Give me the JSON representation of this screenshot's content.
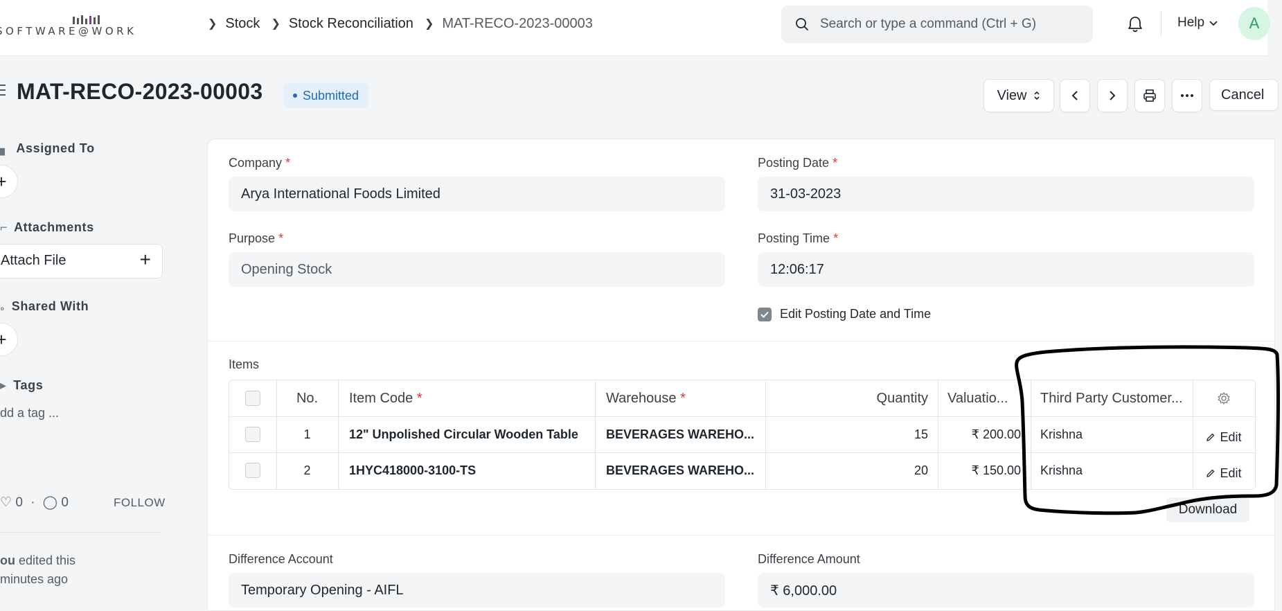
{
  "app": {
    "logo_text": "SOFTWARE@WORK"
  },
  "breadcrumb": [
    "Stock",
    "Stock Reconciliation",
    "MAT-RECO-2023-00003"
  ],
  "search": {
    "placeholder": "Search or type a command (Ctrl + G)"
  },
  "navbar": {
    "help_label": "Help",
    "avatar_initial": "A"
  },
  "page": {
    "title": "MAT-RECO-2023-00003",
    "status": "Submitted",
    "actions": {
      "view_label": "View",
      "cancel_label": "Cancel"
    }
  },
  "sidebar": {
    "assigned_to": "Assigned To",
    "attachments": "Attachments",
    "attach_file": "Attach File",
    "shared_with": "Shared With",
    "tags": "Tags",
    "add_tag": "dd a tag ...",
    "likes": "0",
    "comments": "0",
    "follow": "FOLLOW",
    "activity_line1_bold": "ou",
    "activity_line1_rest": " edited this",
    "activity_line2": "minutes ago"
  },
  "form": {
    "company_label": "Company",
    "company_value": "Arya International Foods Limited",
    "posting_date_label": "Posting Date",
    "posting_date_value": "31-03-2023",
    "purpose_label": "Purpose",
    "purpose_value": "Opening Stock",
    "posting_time_label": "Posting Time",
    "posting_time_value": "12:06:17",
    "edit_posting_label": "Edit Posting Date and Time",
    "edit_posting_checked": true,
    "items_label": "Items",
    "difference_account_label": "Difference Account",
    "difference_account_value": "Temporary Opening - AIFL",
    "difference_amount_label": "Difference Amount",
    "difference_amount_value": "₹ 6,000.00"
  },
  "items_table": {
    "columns": [
      "No.",
      "Item Code",
      "Warehouse",
      "Quantity",
      "Valuatio...",
      "Third Party Customer..."
    ],
    "rows": [
      {
        "no": "1",
        "item_code": "12\" Unpolished Circular Wooden Table",
        "warehouse": "BEVERAGES WAREHO...",
        "quantity": "15",
        "valuation": "₹ 200.00",
        "customer": "Krishna",
        "edit": "Edit"
      },
      {
        "no": "2",
        "item_code": "1HYC418000-3100-TS",
        "warehouse": "BEVERAGES WAREHO...",
        "quantity": "20",
        "valuation": "₹ 150.00",
        "customer": "Krishna",
        "edit": "Edit"
      }
    ],
    "download_label": "Download"
  },
  "colors": {
    "badge_bg": "#e4f0fb",
    "badge_text": "#1e6cb6",
    "required": "#e03636",
    "annotation": "#000000"
  }
}
